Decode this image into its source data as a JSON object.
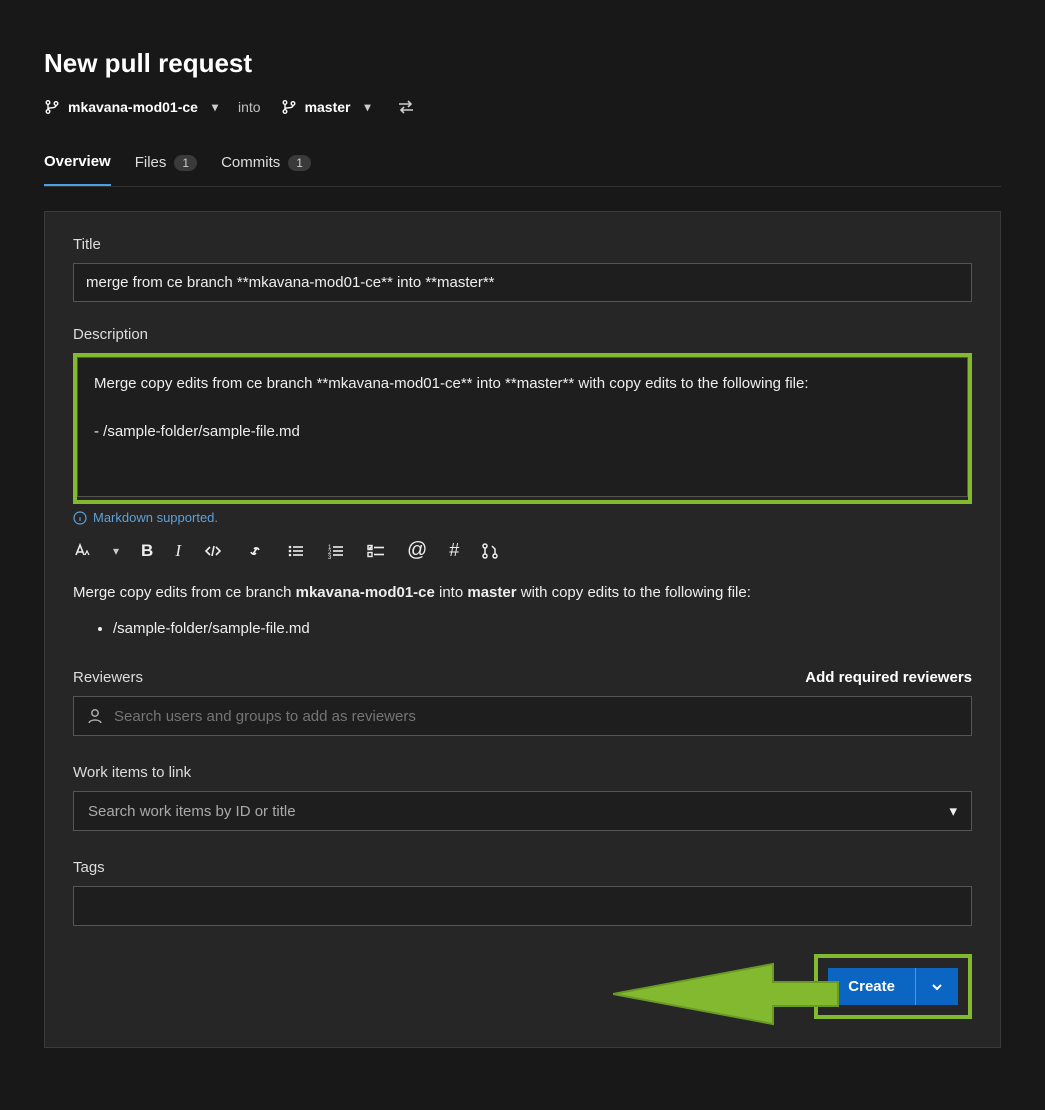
{
  "page_title": "New pull request",
  "branches": {
    "source": "mkavana-mod01-ce",
    "into_label": "into",
    "target": "master"
  },
  "tabs": [
    {
      "label": "Overview",
      "active": true
    },
    {
      "label": "Files",
      "count": "1"
    },
    {
      "label": "Commits",
      "count": "1"
    }
  ],
  "form": {
    "title_label": "Title",
    "title_value": "merge from ce branch **mkavana-mod01-ce** into **master**",
    "description_label": "Description",
    "description_value": "Merge copy edits from ce branch **mkavana-mod01-ce** into **master** with copy edits to the following file:\n\n- /sample-folder/sample-file.md",
    "markdown_support": "Markdown supported."
  },
  "preview": {
    "line1_prefix": "Merge copy edits from ce branch ",
    "bold1": "mkavana-mod01-ce",
    "mid": " into ",
    "bold2": "master",
    "suffix": " with copy edits to the following file:",
    "bullet": "/sample-folder/sample-file.md"
  },
  "reviewers": {
    "label": "Reviewers",
    "action": "Add required reviewers",
    "placeholder": "Search users and groups to add as reviewers"
  },
  "work_items": {
    "label": "Work items to link",
    "placeholder": "Search work items by ID or title"
  },
  "tags": {
    "label": "Tags"
  },
  "create_button": "Create"
}
